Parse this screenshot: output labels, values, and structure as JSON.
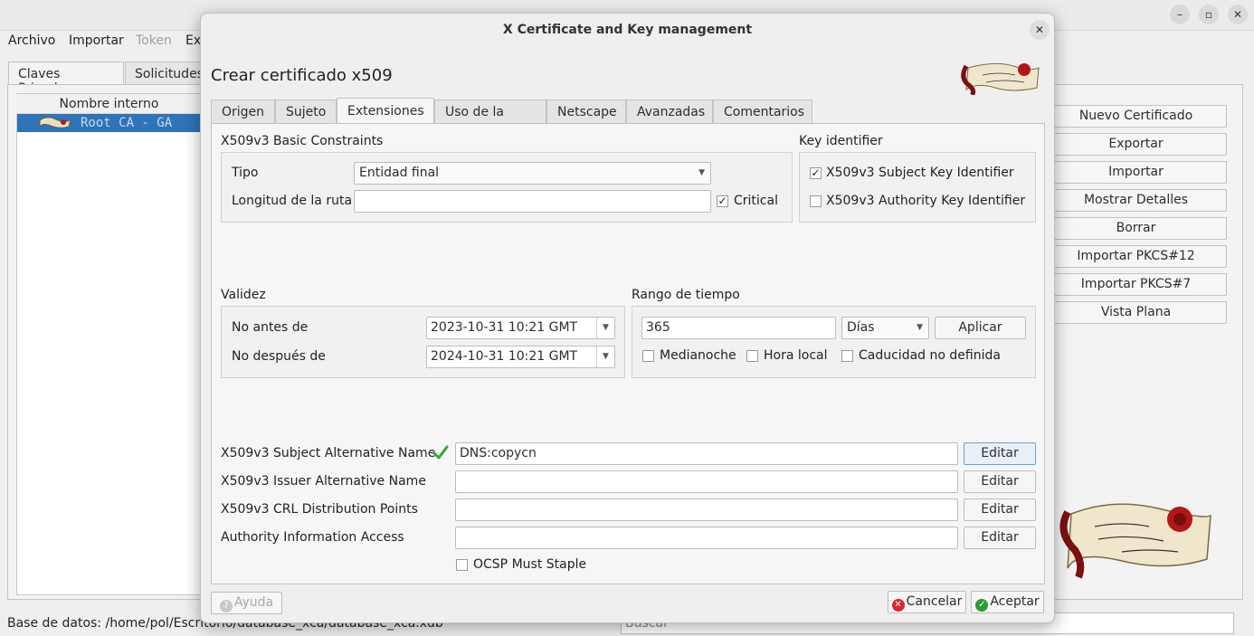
{
  "menu": {
    "archivo": "Archivo",
    "importar": "Importar",
    "token": "Token",
    "extra": "Ex"
  },
  "main": {
    "tabs": [
      "Claves Privadas",
      "Solicitudes"
    ],
    "list_header": "Nombre interno",
    "list_rows": [
      "Root CA - GA"
    ],
    "side_buttons": [
      "Nuevo Certificado",
      "Exportar",
      "Importar",
      "Mostrar Detalles",
      "Borrar",
      "Importar PKCS#12",
      "Importar PKCS#7",
      "Vista Plana"
    ],
    "status": "Base de datos: /home/pol/Escritorio/database_xca/database_xca.xdb",
    "search_placeholder": "Buscar"
  },
  "dialog": {
    "title": "X Certificate and Key management",
    "heading": "Crear certificado x509",
    "tabs": [
      "Origen",
      "Sujeto",
      "Extensiones",
      "Uso de la clave",
      "Netscape",
      "Avanzadas",
      "Comentarios"
    ],
    "active_tab": "Extensiones",
    "basic_constraints": {
      "title": "X509v3 Basic Constraints",
      "tipo_label": "Tipo",
      "tipo_value": "Entidad final",
      "longitud_label": "Longitud de la ruta",
      "longitud_value": "",
      "critical_label": "Critical",
      "critical_checked": true
    },
    "key_identifier": {
      "title": "Key identifier",
      "subject_label": "X509v3 Subject Key Identifier",
      "subject_checked": true,
      "authority_label": "X509v3 Authority Key Identifier",
      "authority_checked": false
    },
    "validez": {
      "title": "Validez",
      "not_before_label": "No antes de",
      "not_before_value": "2023-10-31 10:21 GMT",
      "not_after_label": "No después de",
      "not_after_value": "2024-10-31 10:21 GMT"
    },
    "rango": {
      "title": "Rango de tiempo",
      "amount": "365",
      "unit": "Días",
      "apply_label": "Aplicar",
      "medianoche_label": "Medianoche",
      "hora_local_label": "Hora local",
      "caducidad_label": "Caducidad no definida"
    },
    "extensions": [
      {
        "label": "X509v3 Subject Alternative Name",
        "value": "DNS:copycn",
        "button": "Editar",
        "valid": true
      },
      {
        "label": "X509v3 Issuer Alternative Name",
        "value": "",
        "button": "Editar"
      },
      {
        "label": "X509v3 CRL Distribution Points",
        "value": "",
        "button": "Editar"
      },
      {
        "label": "Authority Information Access",
        "value": "",
        "button": "Editar"
      }
    ],
    "ocsp_label": "OCSP Must Staple",
    "help_label": "Ayuda",
    "cancel_label": "Cancelar",
    "accept_label": "Aceptar"
  },
  "colors": {
    "selection": "#2f73bb",
    "cancel_icon": "#d9262b",
    "accept_icon": "#2e9a3a",
    "valid_check": "#3aa63a",
    "logo_red": "#8b1a1a"
  },
  "icons": {
    "valid": "check-icon",
    "help": "help-icon",
    "cancel": "cancel-icon",
    "accept": "accept-icon",
    "logo": "scroll-logo-icon",
    "close": "close-icon"
  }
}
